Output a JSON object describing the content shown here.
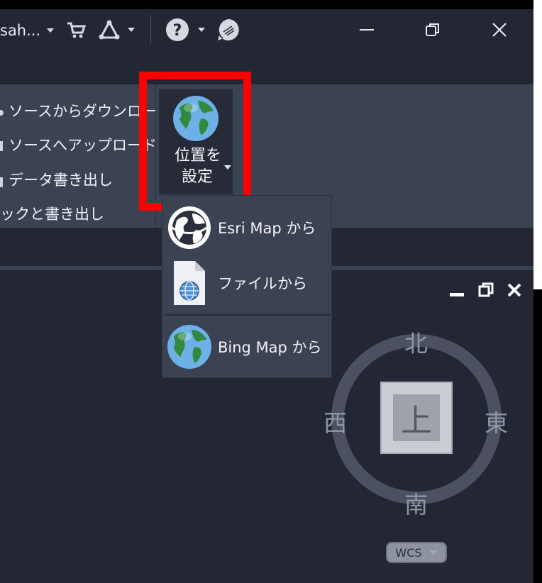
{
  "titlebar": {
    "user_name": "sah...",
    "icons": [
      "cart-icon",
      "autodesk-app-icon",
      "help-icon",
      "chat-icon"
    ],
    "window_controls": [
      "minimize-icon",
      "restore-icon",
      "close-icon"
    ]
  },
  "ribbon": {
    "items": [
      {
        "label": "ソースからダウンロード",
        "icon": "download-icon"
      },
      {
        "label": "ソースへアップロード",
        "icon": "upload-icon"
      },
      {
        "label": "データ書き出し",
        "icon": "export-icon"
      },
      {
        "label": "ックと書き出し",
        "icon": "export-icon"
      }
    ],
    "set_location": {
      "label_line1": "位置を",
      "label_line2": "設定",
      "icon": "globe-icon"
    }
  },
  "dropdown": {
    "items": [
      {
        "label": "Esri Map から",
        "icon": "esri-globe-icon"
      },
      {
        "label": "ファイルから",
        "icon": "file-globe-icon"
      },
      {
        "label": "Bing Map から",
        "icon": "globe-icon"
      }
    ]
  },
  "viewcube": {
    "north": "北",
    "south": "南",
    "east": "東",
    "west": "西",
    "face": "上",
    "wcs": "WCS",
    "controls": [
      "minimize-icon",
      "restore-icon",
      "close-icon"
    ]
  },
  "colors": {
    "highlight": "#ff0000",
    "background": "#222733",
    "panel": "#3b4353"
  }
}
